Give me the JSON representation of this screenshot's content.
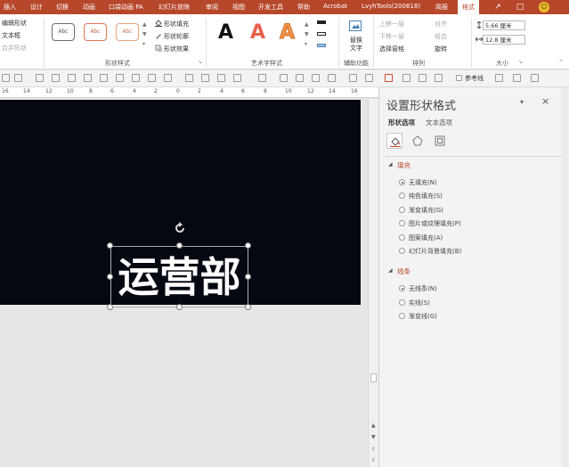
{
  "tabs": [
    {
      "label": "插入"
    },
    {
      "label": "设计"
    },
    {
      "label": "切换"
    },
    {
      "label": "动画"
    },
    {
      "label": "口袋动画 PA"
    },
    {
      "label": "幻灯片放映"
    },
    {
      "label": "审阅"
    },
    {
      "label": "视图"
    },
    {
      "label": "开发工具"
    },
    {
      "label": "帮助"
    },
    {
      "label": "Acrobat"
    },
    {
      "label": "LvyhTools(200618)"
    },
    {
      "label": "简报"
    },
    {
      "label": "格式"
    }
  ],
  "ribbon": {
    "insert_shapes": {
      "edit_shape": "编辑形状",
      "text_box": "文本框",
      "merge_shapes": "合并形状"
    },
    "shape_styles": {
      "label": "形状样式",
      "sample_text": "Abc",
      "fill": "形状填充",
      "outline": "形状轮廓",
      "effects": "形状效果"
    },
    "wordart_styles": {
      "label": "艺术字样式",
      "letter": "A"
    },
    "accessibility": {
      "label": "辅助功能",
      "alt_text_line1": "替换",
      "alt_text_line2": "文字"
    },
    "arrange": {
      "label": "排列",
      "bring_forward": "上移一层",
      "send_backward": "下移一层",
      "selection_pane": "选择窗格",
      "align": "对齐",
      "group": "组合",
      "rotate": "旋转"
    },
    "size": {
      "label": "大小",
      "height": "5.66 厘米",
      "width": "12.8 厘米"
    }
  },
  "quick_toolbar": {
    "reference_line": "参考线"
  },
  "ruler": {
    "ticks": [
      "16",
      "14",
      "12",
      "10",
      "8",
      "6",
      "4",
      "2",
      "0",
      "2",
      "4",
      "6",
      "8",
      "10",
      "12",
      "14",
      "16"
    ]
  },
  "slide": {
    "text": "运营部"
  },
  "format_pane": {
    "title": "设置形状格式",
    "tab_shape_options": "形状选项",
    "tab_text_options": "文本选项",
    "fill_section": {
      "title": "填充",
      "options": [
        {
          "label": "无填充(N)",
          "checked": true
        },
        {
          "label": "纯色填充(S)",
          "checked": false
        },
        {
          "label": "渐变填充(G)",
          "checked": false
        },
        {
          "label": "图片或纹理填充(P)",
          "checked": false
        },
        {
          "label": "图案填充(A)",
          "checked": false
        },
        {
          "label": "幻灯片背景填充(B)",
          "checked": false
        }
      ]
    },
    "line_section": {
      "title": "线条",
      "options": [
        {
          "label": "无线条(N)",
          "checked": true
        },
        {
          "label": "实线(S)",
          "checked": false
        },
        {
          "label": "渐变线(G)",
          "checked": false
        }
      ]
    }
  },
  "colors": {
    "accent": "#b7472a",
    "slide_bg": "#040811",
    "wordart_red": "#e8604c",
    "wordart_orange": "#f0954a"
  }
}
